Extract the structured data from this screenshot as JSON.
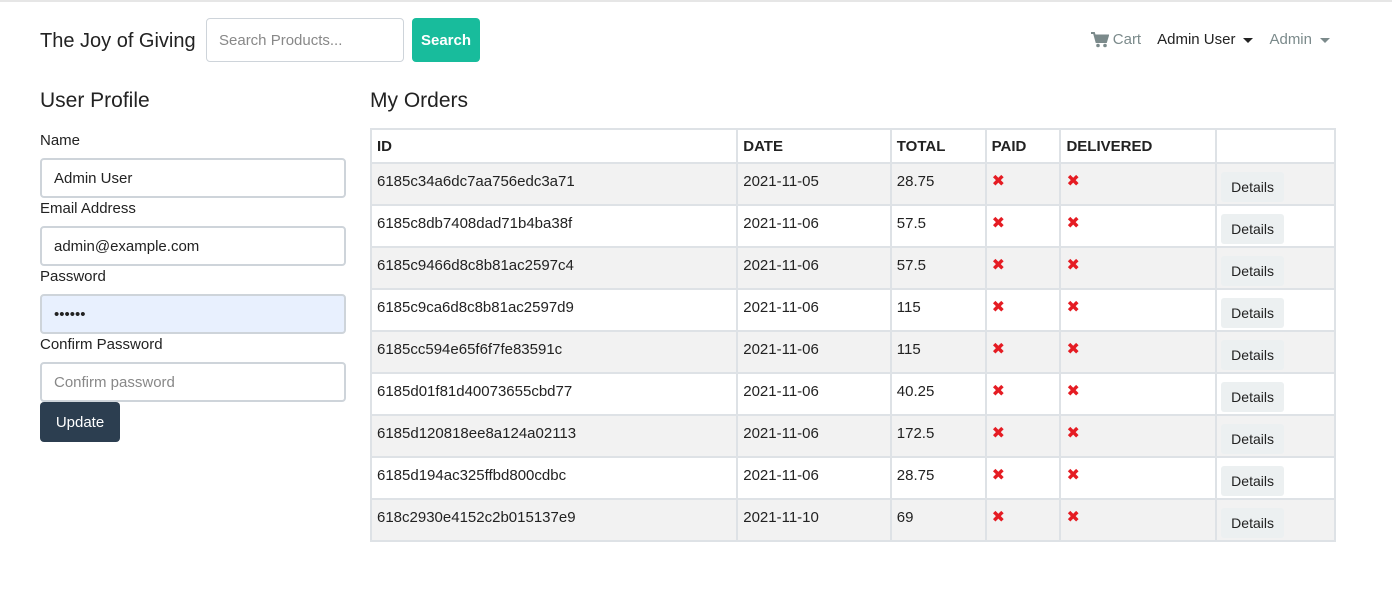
{
  "navbar": {
    "brand": "The Joy of Giving",
    "search_placeholder": "Search Products...",
    "search_button": "Search",
    "cart_label": "Cart",
    "user_menu": "Admin User",
    "admin_menu": "Admin"
  },
  "profile": {
    "title": "User Profile",
    "name_label": "Name",
    "name_value": "Admin User",
    "email_label": "Email Address",
    "email_value": "admin@example.com",
    "password_label": "Password",
    "password_value": "••••••",
    "confirm_label": "Confirm Password",
    "confirm_placeholder": "Confirm password",
    "update_button": "Update"
  },
  "orders": {
    "title": "My Orders",
    "columns": [
      "ID",
      "DATE",
      "TOTAL",
      "PAID",
      "DELIVERED",
      ""
    ],
    "details_label": "Details",
    "status_icon": "x-icon",
    "status_color": "#e51c23",
    "rows": [
      {
        "id": "6185c34a6dc7aa756edc3a71",
        "date": "2021-11-05",
        "total": "28.75"
      },
      {
        "id": "6185c8db7408dad71b4ba38f",
        "date": "2021-11-06",
        "total": "57.5"
      },
      {
        "id": "6185c9466d8c8b81ac2597c4",
        "date": "2021-11-06",
        "total": "57.5"
      },
      {
        "id": "6185c9ca6d8c8b81ac2597d9",
        "date": "2021-11-06",
        "total": "115"
      },
      {
        "id": "6185cc594e65f6f7fe83591c",
        "date": "2021-11-06",
        "total": "115"
      },
      {
        "id": "6185d01f81d40073655cbd77",
        "date": "2021-11-06",
        "total": "40.25"
      },
      {
        "id": "6185d120818ee8a124a02113",
        "date": "2021-11-06",
        "total": "172.5"
      },
      {
        "id": "6185d194ac325ffbd800cdbc",
        "date": "2021-11-06",
        "total": "28.75"
      },
      {
        "id": "618c2930e4152c2b015137e9",
        "date": "2021-11-10",
        "total": "69"
      }
    ]
  },
  "colors": {
    "primary": "#2c3e50",
    "success": "#18bc9c",
    "danger": "#e51c23"
  }
}
